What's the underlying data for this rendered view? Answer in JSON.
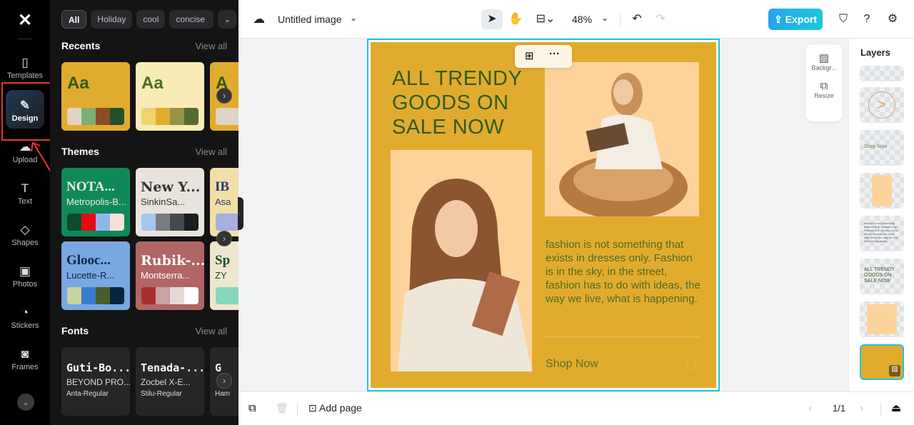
{
  "rail": {
    "items": [
      {
        "label": "Templates",
        "icon": "templates-icon"
      },
      {
        "label": "Design",
        "icon": "design-icon",
        "active": true
      },
      {
        "label": "Upload",
        "icon": "upload-icon"
      },
      {
        "label": "Text",
        "icon": "text-icon"
      },
      {
        "label": "Shapes",
        "icon": "shapes-icon"
      },
      {
        "label": "Photos",
        "icon": "photos-icon"
      },
      {
        "label": "Stickers",
        "icon": "stickers-icon"
      },
      {
        "label": "Frames",
        "icon": "frames-icon"
      }
    ]
  },
  "panel": {
    "chips": [
      "All",
      "Holiday",
      "cool",
      "concise"
    ],
    "recents": {
      "title": "Recents",
      "view_all": "View all",
      "cards": [
        {
          "text": "Aa",
          "bg": "#e1ac2e",
          "fg": "#2e5a1c",
          "colors": [
            "#e0d3c5",
            "#7fae74",
            "#8b4d24",
            "#22502a"
          ]
        },
        {
          "text": "Aa",
          "bg": "#f8ebb7",
          "fg": "#4e6b22",
          "colors": [
            "#f1d36d",
            "#e1ac2e",
            "#959346",
            "#546a33"
          ]
        },
        {
          "text": "A",
          "bg": "#e1ac2e",
          "fg": "#2e5a1c",
          "colors": [
            "#e0d3c5"
          ]
        }
      ]
    },
    "themes": {
      "title": "Themes",
      "view_all": "View all",
      "cards": [
        {
          "t1": "NOTA...",
          "t2": "Metropolis-B...",
          "bg": "#0e8a5a",
          "fg": "#f7e7da",
          "colors": [
            "#0d4a2e",
            "#e50914",
            "#93b5ef",
            "#f3e3d8"
          ]
        },
        {
          "t1": "New Y...",
          "t2": "SinkinSa...",
          "bg": "#e8e3dc",
          "fg": "#333",
          "colors": [
            "#a3c7ef",
            "#7a7d80",
            "#45494e",
            "#1c1f22"
          ]
        },
        {
          "t1": "IB",
          "t2": "Asa",
          "bg": "#f2dfa7",
          "fg": "#2a3a7a",
          "colors": [
            "#a8aede"
          ]
        },
        {
          "t1": "Glooc...",
          "t2": "Lucette-R...",
          "bg": "#79a7e1",
          "fg": "#0d2640",
          "colors": [
            "#c8d3a4",
            "#3b7bcd",
            "#4a5c2e",
            "#062640"
          ]
        },
        {
          "t1": "Rubik-...",
          "t2": "Montserra...",
          "bg": "#b16565",
          "fg": "#fff",
          "colors": [
            "#a72f33",
            "#c9a3a3",
            "#e7d8d8",
            "#fff"
          ]
        },
        {
          "t1": "Sp",
          "t2": "ZY",
          "bg": "#efe6cf",
          "fg": "#1d4a32",
          "colors": [
            "#86d7b9"
          ]
        }
      ]
    },
    "fonts": {
      "title": "Fonts",
      "view_all": "View all",
      "cards": [
        {
          "t1": "Guti-Bo...",
          "t2": "BEYOND PRO...",
          "t3": "Anta-Regular"
        },
        {
          "t1": "Tenada-...",
          "t2": "Zocbel X-E...",
          "t3": "Stilu-Regular"
        },
        {
          "t1": "G",
          "t2": "",
          "t3": "Ham"
        }
      ]
    }
  },
  "topbar": {
    "title": "Untitled image",
    "zoom": "48%",
    "export": "Export"
  },
  "poster": {
    "headline": "ALL TRENDY GOODS ON SALE NOW",
    "body": "fashion is not something that exists in dresses only. Fashion is in the sky, in the street, fashion has to do with ideas, the way we live, what is happening.",
    "cta": "Shop Now",
    "bg": "#e1ac2e",
    "text_color": "#2e5a1c"
  },
  "side_tools": {
    "background": "Backgr...",
    "resize": "Resize"
  },
  "layers": {
    "title": "Layers",
    "items": [
      "",
      "circle-arrow",
      "Shop Now",
      "photo-woman-book",
      "body-text",
      "ALL TRENDY GOODS ON SALE NOW",
      "photo-woman-chair",
      "background"
    ]
  },
  "bottombar": {
    "add_page": "Add page",
    "page": "1/1"
  }
}
